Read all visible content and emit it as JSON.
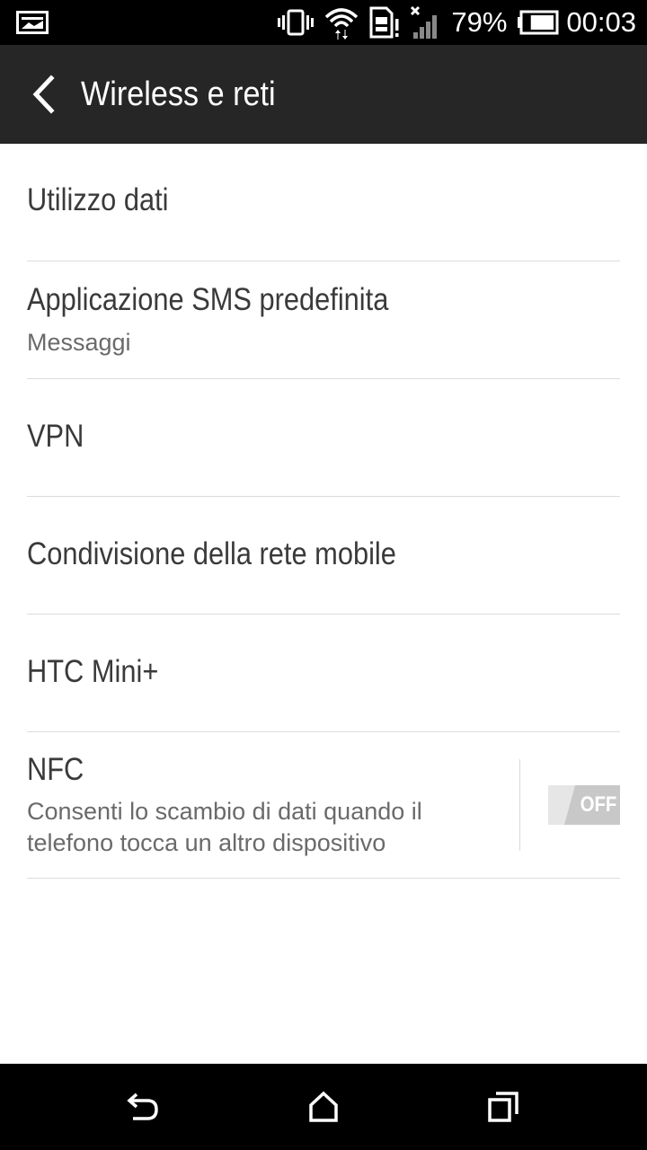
{
  "status_bar": {
    "battery_percent": "79%",
    "battery_level": 0.79,
    "time": "00:03",
    "icons": [
      "image-notification-icon",
      "vibrate-icon",
      "wifi-data-icon",
      "sim-alert-icon",
      "no-signal-icon",
      "battery-icon"
    ]
  },
  "header": {
    "title": "Wireless e reti",
    "back_icon": "chevron-left-icon"
  },
  "settings": {
    "items": [
      {
        "title": "Utilizzo dati"
      },
      {
        "title": "Applicazione SMS predefinita",
        "subtitle": "Messaggi"
      },
      {
        "title": "VPN"
      },
      {
        "title": "Condivisione della rete mobile"
      },
      {
        "title": "HTC Mini+"
      }
    ],
    "nfc": {
      "title": "NFC",
      "subtitle_line1": "Consenti lo scambio di dati quando il",
      "subtitle_line2": "telefono tocca un altro dispositivo",
      "toggle_label": "OFF",
      "enabled": false
    }
  },
  "nav_bar": {
    "buttons": [
      "back-icon",
      "home-icon",
      "recent-apps-icon"
    ]
  },
  "colors": {
    "status_bar_bg": "#000000",
    "action_bar_bg": "#262626",
    "list_bg": "#ffffff",
    "title_text": "#3a3a3a",
    "subtitle_text": "#6a6a6a",
    "divider": "#dcdcdc",
    "toggle_off": "#c8c8c8"
  }
}
